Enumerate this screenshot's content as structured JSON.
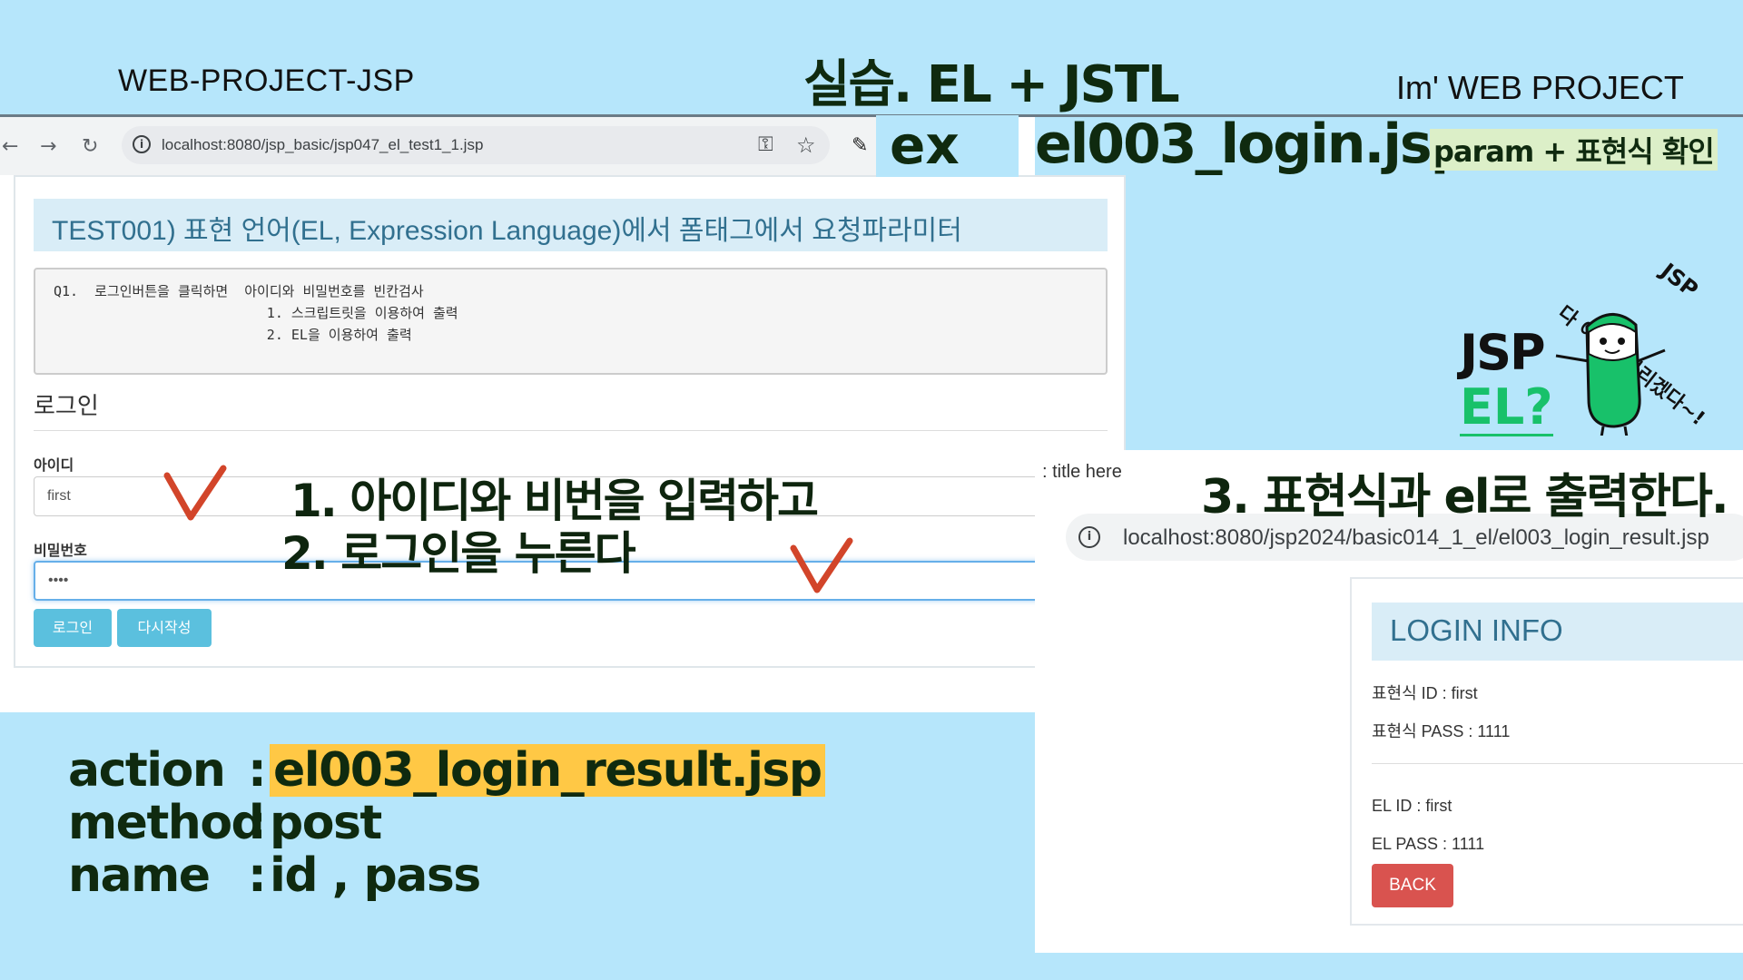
{
  "header": {
    "left": "WEB-PROJECT-JSP",
    "center": "실습. EL + JSTL",
    "right": "Im' WEB PROJECT"
  },
  "ex": {
    "label": "ex",
    "file": "el003_login.jsp",
    "tag": "param  + 표현식 확인"
  },
  "login_browser": {
    "url": "localhost:8080/jsp_basic/jsp047_el_test1_1.jsp",
    "title": "TEST001) 표현 언어(EL, Expression Language)에서 폼태그에서 요청파라미터",
    "question": "Q1.  로그인버튼을 클릭하면  아이디와 비밀번호를 빈칸검사\n                          1. 스크립트릿을 이용하여 출력\n                          2. EL을 이용하여 출력",
    "heading": "로그인",
    "id_label": "아이디",
    "id_value": "first",
    "pw_label": "비밀번호",
    "pw_value": "••••",
    "login_button": "로그인",
    "reset_button": "다시작성"
  },
  "steps": {
    "step1": "1. 아이디와 비번을 입력하고",
    "step2": "2. 로그인을 누른다",
    "step3": "3.  표현식과 el로 출력한다."
  },
  "mascot": {
    "jsp": "JSP",
    "el": "EL?",
    "bubble": "다 이해해버리겠다~!",
    "bubble_jsp": "JSP"
  },
  "form_spec": {
    "action_key": "action",
    "action_val": "el003_login_result.jsp",
    "method_key": "method",
    "method_val": "post",
    "name_key": "name",
    "name_val": "id , pass"
  },
  "result_browser": {
    "tab_title": ": title here",
    "url": "localhost:8080/jsp2024/basic014_1_el/el003_login_result.jsp",
    "info_title": "LOGIN INFO",
    "expr_id": "표현식 ID : first",
    "expr_pass": "표현식 PASS : 1111",
    "el_id": "EL ID : first",
    "el_pass": "EL PASS : 1111",
    "back_button": "BACK"
  },
  "colors": {
    "background": "#b6e6fb",
    "highlight": "#ffc845",
    "info_bg": "#d9edf7",
    "btn_info": "#5bc0de",
    "btn_danger": "#d9534f",
    "mascot_green": "#18c16a"
  }
}
